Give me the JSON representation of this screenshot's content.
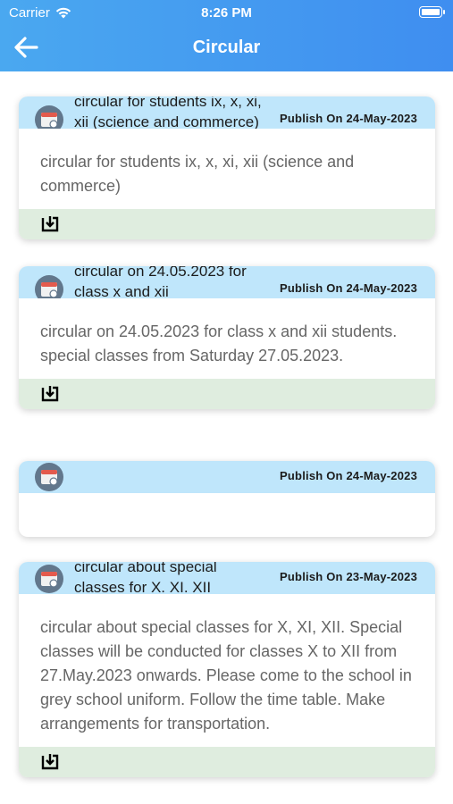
{
  "status": {
    "carrier": "Carrier",
    "time": "8:26 PM"
  },
  "header": {
    "title": "Circular",
    "color": "#4aa8f0"
  },
  "cards": [
    {
      "title": "circular for students ix, x, xi, xii (science and commerce)",
      "publish": "Publish On 24-May-2023",
      "body": "circular for students ix, x, xi, xii (science and commerce)",
      "has_download": true
    },
    {
      "title": "circular on 24.05.2023 for class x and xii",
      "publish": "Publish On 24-May-2023",
      "body": "circular on 24.05.2023 for class x and xii students. special classes from Saturday 27.05.2023.",
      "has_download": true
    },
    {
      "title": "",
      "publish": "Publish On 24-May-2023",
      "body": "",
      "has_download": false
    },
    {
      "title": "circular about special classes for X. XI. XII",
      "publish": "Publish On 23-May-2023",
      "body": "circular about special classes for X, XI, XII. Special classes will be conducted for classes X to XII from 27.May.2023 onwards. Please come to the school in grey school uniform. Follow the time table. Make arrangements for transportation.",
      "has_download": true
    }
  ],
  "icons": {
    "back": "arrow-left-icon",
    "calendar": "calendar-icon",
    "download": "download-icon",
    "wifi": "wifi-icon",
    "battery": "battery-icon"
  },
  "colors": {
    "card_header": "#bfe6fb",
    "card_footer": "#dfeddf",
    "calendar_bg": "#62778c"
  }
}
